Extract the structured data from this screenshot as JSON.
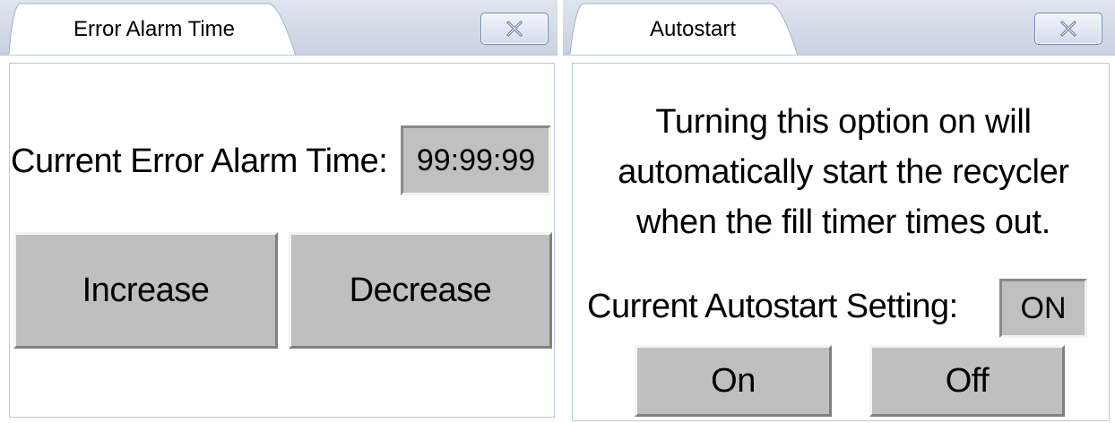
{
  "error_alarm_window": {
    "tab_title": "Error Alarm Time",
    "current_label": "Current Error Alarm Time:",
    "current_value": "99:99:99",
    "increase_label": "Increase",
    "decrease_label": "Decrease"
  },
  "autostart_window": {
    "tab_title": "Autostart",
    "message_lines": [
      "Turning this option on will",
      "automatically start the recycler",
      "when the fill timer times out."
    ],
    "setting_label": "Current Autostart Setting:",
    "setting_value": "ON",
    "on_label": "On",
    "off_label": "Off"
  },
  "icons": {
    "close": "close-icon"
  },
  "colors": {
    "tab_strip": "#c9d1e0",
    "tab_face": "#ffffff",
    "button_face": "#bfbfbf",
    "value_face": "#c0c0c0",
    "close_border": "#6e88b0"
  }
}
